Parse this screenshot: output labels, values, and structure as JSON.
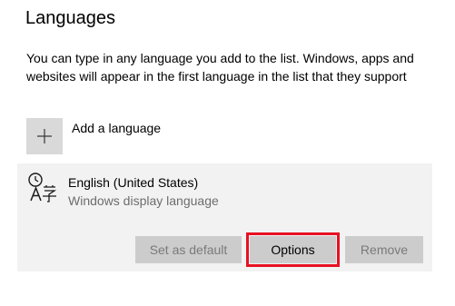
{
  "section": {
    "title": "Languages",
    "description": "You can type in any language you add to the list. Windows, apps and websites will appear in the first language in the list that they support"
  },
  "add_language": {
    "icon": "plus-icon",
    "label": "Add a language"
  },
  "languages": [
    {
      "icon": "language-icon",
      "name": "English (United States)",
      "subtitle": "Windows display language",
      "buttons": {
        "set_default": "Set as default",
        "options": "Options",
        "remove": "Remove"
      }
    }
  ],
  "colors": {
    "highlight_border": "#e81123",
    "tile_bg": "#d9d9d9",
    "card_bg": "#f2f2f2",
    "button_bg": "#cccccc",
    "disabled_text": "#7a7a7a",
    "secondary_text": "#6d6d6d"
  }
}
